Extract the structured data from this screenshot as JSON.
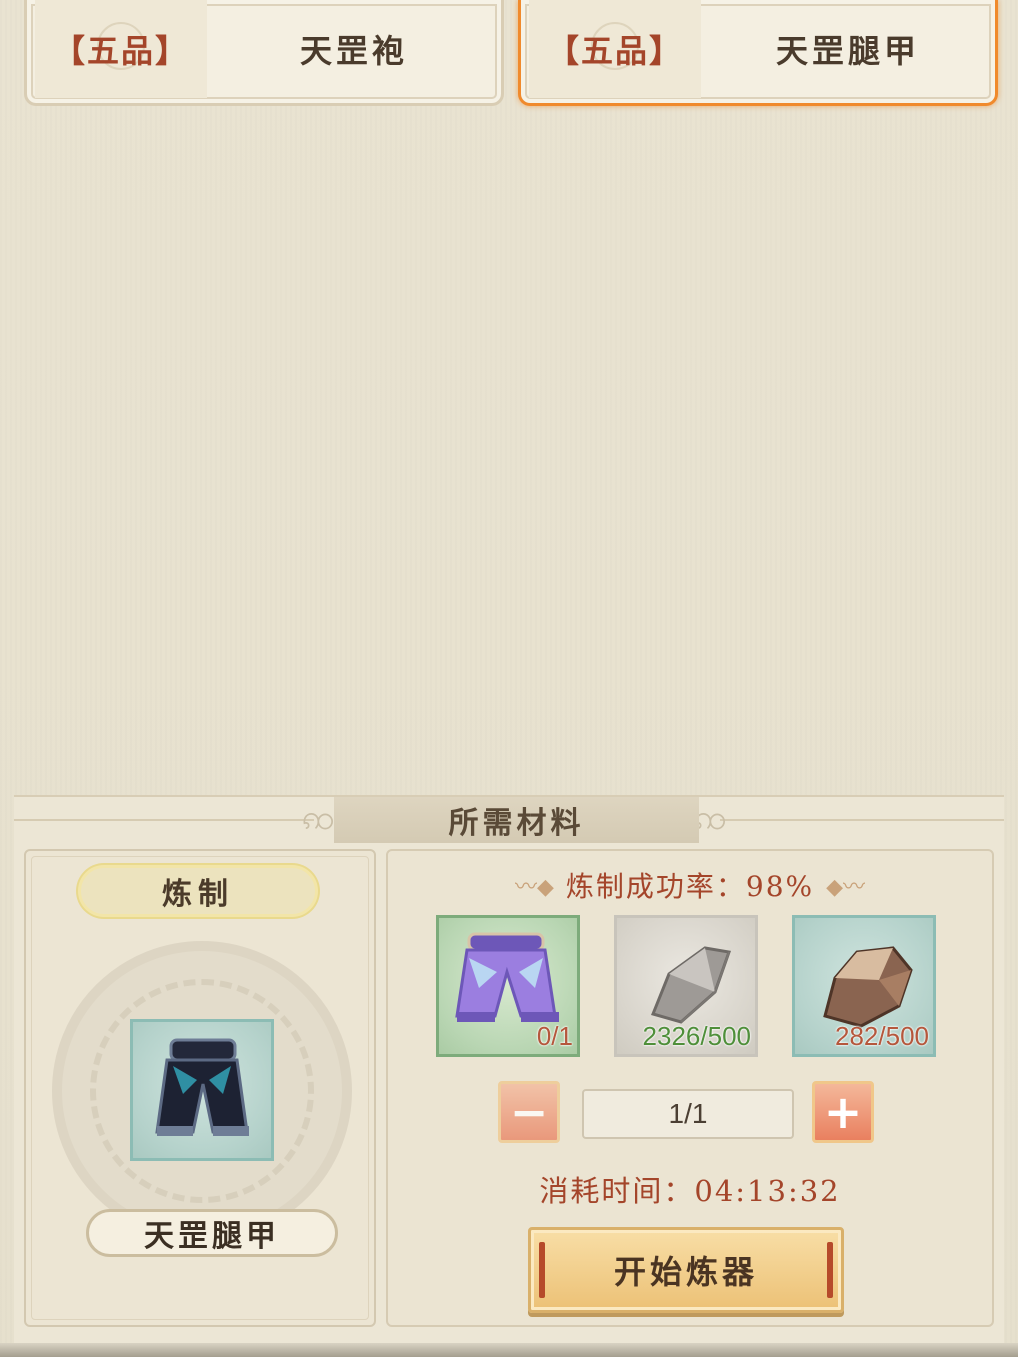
{
  "recipes": [
    {
      "grade": "【五品】",
      "name": "天罡袍",
      "selected": false
    },
    {
      "grade": "【五品】",
      "name": "天罡腿甲",
      "selected": true
    }
  ],
  "materials_panel": {
    "title": "所需材料",
    "craft_label": "炼制",
    "product": {
      "name": "天罡腿甲",
      "icon": "dark-leg-armor-icon"
    },
    "success_rate_text": "炼制成功率：98%",
    "materials": [
      {
        "icon": "purple-leg-armor-icon",
        "count": "0/1",
        "count_color": "#b5573c"
      },
      {
        "icon": "gray-ore-icon",
        "count": "2326/500",
        "count_color": "#4f8f3a"
      },
      {
        "icon": "brown-ore-icon",
        "count": "282/500",
        "count_color": "#b5573c"
      }
    ],
    "quantity": "1/1",
    "minus_label": "−",
    "plus_label": "+",
    "time_text": "消耗时间：04:13:32",
    "start_label": "开始炼器"
  },
  "colors": {
    "accent_red": "#a4452a",
    "selected_border": "#f08a2c",
    "button_gold": "#ecc176"
  }
}
